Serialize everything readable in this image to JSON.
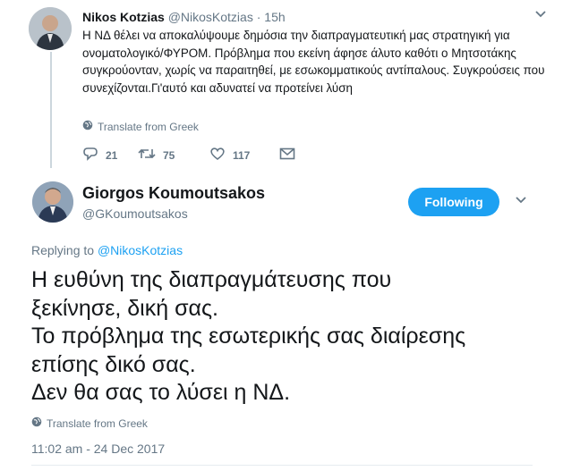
{
  "parent_tweet": {
    "name": "Nikos Kotzias",
    "handle": "@NikosKotzias",
    "time": "15h",
    "text": "Η ΝΔ θέλει να αποκαλύψουμε δημόσια την διαπραγματευτική μας στρατηγική για ονοματολογικό/ΦΥΡΟΜ. Πρόβλημα που εκείνη άφησε άλυτο καθότι ο Μητσοτάκης συγκρούονταν, χωρίς να παραιτηθεί, με εσωκομματικούς αντίπαλους. Συγκρούσεις που συνεχίζονται.Γι'αυτό και αδυνατεί να προτείνει λύση",
    "translate_label": "Translate from Greek",
    "replies": "21",
    "retweets": "75",
    "likes": "117"
  },
  "main_tweet": {
    "name": "Giorgos Koumoutsakos",
    "handle": "@GKoumoutsakos",
    "follow_label": "Following",
    "replying_prefix": "Replying to",
    "replying_to": "@NikosKotzias",
    "lines": [
      "Η ευθύνη της διαπραγμάτευσης που",
      "ξεκίνησε, δική σας.",
      "Το πρόβλημα της εσωτερικής σας διαίρεσης",
      "επίσης δικό σας.",
      "Δεν θα σας το λύσει η ΝΔ."
    ],
    "translate_label": "Translate from Greek",
    "timestamp": "11:02 am - 24 Dec 2017"
  },
  "colors": {
    "accent": "#1da1f2",
    "muted": "#657786",
    "text": "#14171a"
  },
  "icons": [
    "chevron-down-icon",
    "globe-icon",
    "reply-icon",
    "retweet-icon",
    "heart-icon",
    "direct-message-icon"
  ]
}
